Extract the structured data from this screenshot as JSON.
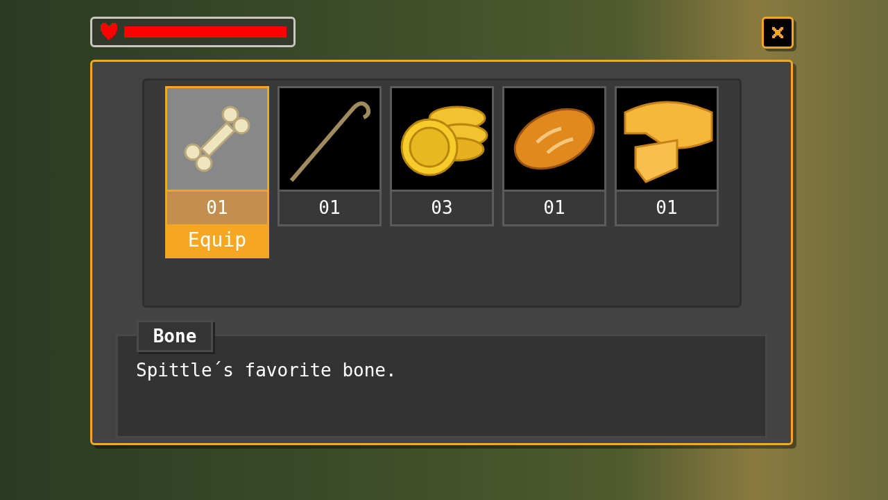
{
  "health": {
    "level": 1.0
  },
  "inventory": {
    "items": [
      {
        "kind": "bone",
        "count": "01",
        "selected": true,
        "action": "Equip"
      },
      {
        "kind": "staff",
        "count": "01",
        "selected": false
      },
      {
        "kind": "coins",
        "count": "03",
        "selected": false
      },
      {
        "kind": "bread",
        "count": "01",
        "selected": false
      },
      {
        "kind": "cheese",
        "count": "01",
        "selected": false
      }
    ]
  },
  "description": {
    "title": "Bone",
    "text": "Spittle´s favorite bone."
  }
}
